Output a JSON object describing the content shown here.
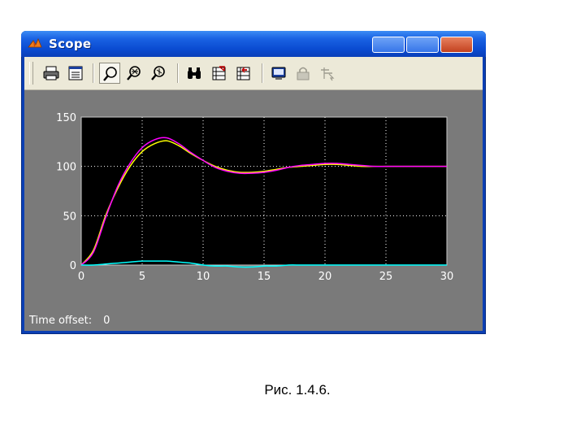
{
  "window": {
    "title": "Scope",
    "app_icon": "matlab-logo-icon",
    "title_buttons": [
      "minimize-button",
      "maximize-button",
      "close-button"
    ]
  },
  "toolbar": {
    "tools": [
      "print-icon",
      "parameters-icon",
      "zoom-icon",
      "zoom-x-icon",
      "zoom-y-icon",
      "autoscale-binoculars-icon",
      "save-axes-icon",
      "restore-axes-icon",
      "floating-scope-icon",
      "lock-axes-icon",
      "signal-selection-icon"
    ],
    "pressed_tool": "zoom-icon"
  },
  "status": {
    "time_offset_label": "Time offset:",
    "time_offset_value": "0"
  },
  "caption": "Рис. 1.4.6.",
  "colors": {
    "plot_background": "#000000",
    "figure_background": "#7a7a7a",
    "series_yellow": "#ffff00",
    "series_magenta": "#ff00ff",
    "series_cyan": "#00ffff",
    "grid": "#ffffff"
  },
  "chart_data": {
    "type": "line",
    "xlim": [
      0,
      30
    ],
    "ylim": [
      0,
      150
    ],
    "x_ticks": [
      0,
      5,
      10,
      15,
      20,
      25,
      30
    ],
    "y_ticks": [
      0,
      50,
      100,
      150
    ],
    "grid": true,
    "series": [
      {
        "color": "#ffff00",
        "x": [
          0,
          1,
          2,
          3,
          4,
          5,
          6,
          7,
          8,
          9,
          10,
          11,
          12,
          13,
          14,
          15,
          16,
          17,
          18,
          19,
          20,
          21,
          22,
          23,
          24,
          25,
          26,
          27,
          28,
          29,
          30
        ],
        "y": [
          0,
          15,
          50,
          78,
          100,
          115,
          123,
          126,
          121,
          113,
          106,
          100,
          96,
          94,
          94,
          95,
          97,
          99,
          100,
          101,
          102,
          102,
          101,
          100,
          100,
          100,
          100,
          100,
          100,
          100,
          100
        ]
      },
      {
        "color": "#ff00ff",
        "x": [
          0,
          1,
          2,
          3,
          4,
          5,
          6,
          7,
          8,
          9,
          10,
          11,
          12,
          13,
          14,
          15,
          16,
          17,
          18,
          19,
          20,
          21,
          22,
          23,
          24,
          25,
          26,
          27,
          28,
          29,
          30
        ],
        "y": [
          0,
          13,
          48,
          80,
          103,
          119,
          127,
          129,
          123,
          114,
          106,
          99,
          95,
          93,
          93,
          94,
          96,
          99,
          101,
          102,
          103,
          103,
          102,
          101,
          100,
          100,
          100,
          100,
          100,
          100,
          100
        ]
      },
      {
        "color": "#00ffff",
        "x": [
          0,
          1,
          2,
          3,
          4,
          5,
          6,
          7,
          8,
          9,
          10,
          11,
          12,
          13,
          14,
          15,
          16,
          17,
          18,
          19,
          20,
          21,
          22,
          23,
          24,
          25,
          26,
          27,
          28,
          29,
          30
        ],
        "y": [
          0,
          0,
          1,
          2,
          3,
          4,
          4,
          4,
          3,
          2,
          0,
          -1,
          -1,
          -2,
          -2,
          -1,
          -1,
          0,
          0,
          0,
          0,
          0,
          0,
          0,
          0,
          0,
          0,
          0,
          0,
          0,
          0
        ]
      }
    ]
  }
}
